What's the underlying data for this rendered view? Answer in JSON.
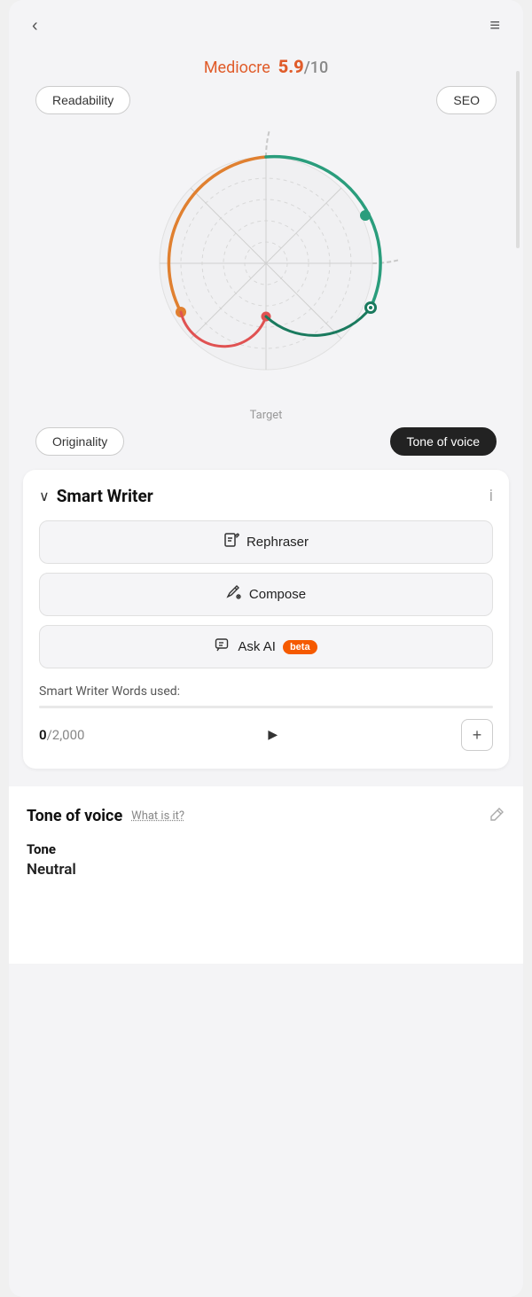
{
  "topBar": {
    "backLabel": "‹",
    "menuLabel": "≡"
  },
  "score": {
    "label": "Mediocre",
    "value": "5.9",
    "denom": "/10"
  },
  "radarLabels": {
    "readability": "Readability",
    "seo": "SEO",
    "originality": "Originality",
    "toneOfVoice": "Tone of voice"
  },
  "targetLabel": "Target",
  "smartWriter": {
    "collapseIcon": "∨",
    "title": "Smart Writer",
    "infoIcon": "i",
    "rephraserLabel": "Rephraser",
    "composeLabel": "Compose",
    "askAiLabel": "Ask AI",
    "betaLabel": "beta",
    "usageLabel": "Smart Writer Words used:",
    "wordsUsed": "0",
    "wordsTotal": "2,000",
    "addLabel": "+"
  },
  "toneOfVoice": {
    "title": "Tone of voice",
    "whatIsItLabel": "What is it?",
    "toneLabel": "Tone",
    "toneValue": "Neutral"
  },
  "colors": {
    "orange": "#e05c2a",
    "teal": "#2a9d7c",
    "red": "#e05252",
    "darkGreen": "#1a7a5e",
    "betaOrange": "#f55a00"
  },
  "radar": {
    "gridColor": "#e0e0e0",
    "arcOrangeStart": "195",
    "arcTealEnd": "80"
  }
}
